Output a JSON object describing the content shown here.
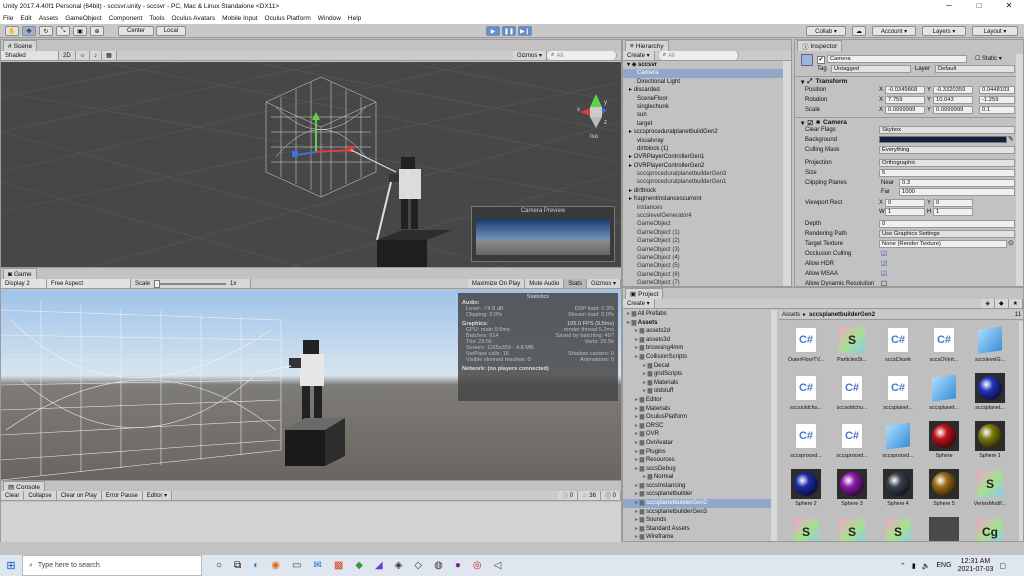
{
  "window": {
    "title": "Unity 2017.4.40f1 Personal (64bit) - sccsvr.unity - sccsvr - PC, Mac & Linux Standalone <DX11>",
    "min": "─",
    "max": "□",
    "close": "✕"
  },
  "menu": [
    "File",
    "Edit",
    "Assets",
    "GameObject",
    "Component",
    "Tools",
    "Oculus Avatars",
    "Mobile Input",
    "Oculus Platform",
    "Window",
    "Help"
  ],
  "toolbar": {
    "center": "Center",
    "local": "Local",
    "collab": "Collab ▾",
    "account": "Account ▾",
    "layers": "Layers ▾",
    "layout": "Layout ▾"
  },
  "scene": {
    "tab": "Scene",
    "shaded": "Shaded",
    "twod": "2D",
    "gizmos": "Gizmos ▾",
    "search": "All",
    "iso": "Iso",
    "axes": {
      "x": "x",
      "y": "y",
      "z": "z"
    }
  },
  "preview": {
    "title": "Camera Preview"
  },
  "game": {
    "tab": "Game",
    "display": "Display 2",
    "aspect": "Free Aspect",
    "scale_label": "Scale",
    "scale_value": "1x",
    "maximize": "Maximize On Play",
    "mute": "Mute Audio",
    "stats": "Stats",
    "gizmos": "Gizmos ▾"
  },
  "stats": {
    "title": "Statistics",
    "audio_h": "Audio:",
    "audio": [
      [
        "Level: -74.8 dB",
        "DSP load: 0.3%"
      ],
      [
        "Clipping: 0.0%",
        "Stream load: 0.0%"
      ]
    ],
    "graphics_h": "Graphics:",
    "fps": "105.0 FPS (9.5ms)",
    "graphics": [
      [
        "CPU: main 9.5ms",
        "render thread 5.2ms"
      ],
      [
        "Batches: 614",
        "Saved by batching: 497"
      ],
      [
        "Tris: 29.5k",
        "Verts: 25.5k"
      ],
      [
        "Screen: 1165x359 - 4.8 MB",
        ""
      ],
      [
        "SetPass calls: 16",
        "Shadow casters: 0"
      ],
      [
        "Visible skinned meshes: 0",
        "Animations: 0"
      ]
    ],
    "network": "Network: (no players connected)"
  },
  "console": {
    "tab": "Console",
    "clear": "Clear",
    "collapse": "Collapse",
    "clear_on_play": "Clear on Play",
    "error_pause": "Error Pause",
    "editor": "Editor ▾",
    "errors": "0",
    "warnings": "36",
    "logs": "0"
  },
  "hierarchy": {
    "tab": "Hierarchy",
    "create": "Create ▾",
    "search": "All",
    "scene": "sccsvr",
    "items": [
      {
        "t": "Camera",
        "sel": true
      },
      {
        "t": "Directional Light"
      },
      {
        "t": "discarded",
        "arrow": true
      },
      {
        "t": "SceneFloor"
      },
      {
        "t": "singlechunk"
      },
      {
        "t": "sun"
      },
      {
        "t": "target"
      },
      {
        "t": "sccsproceduralplanetbuildGen2",
        "arrow": true
      },
      {
        "t": "visualvray"
      },
      {
        "t": "dirtblock (1)"
      },
      {
        "t": "OVRPlayerControllerGen1",
        "arrow": true
      },
      {
        "t": "OVRPlayerControllerGen2",
        "arrow": true
      },
      {
        "t": "sccsproceduralplanetbuilderGen3",
        "g": true
      },
      {
        "t": "sccsproceduralplanetbuilderGen1",
        "g": true
      },
      {
        "t": "dirtblock",
        "arrow": true
      },
      {
        "t": "fragmentinstancescurrent",
        "arrow": true
      },
      {
        "t": "instances",
        "g": true
      },
      {
        "t": "sccslevelGenerator4",
        "g": true
      },
      {
        "t": "GameObject",
        "g": true
      },
      {
        "t": "GameObject (1)",
        "g": true
      },
      {
        "t": "GameObject (2)",
        "g": true
      },
      {
        "t": "GameObject (3)",
        "g": true
      },
      {
        "t": "GameObject (4)",
        "g": true
      },
      {
        "t": "GameObject (5)",
        "g": true
      },
      {
        "t": "GameObject (6)",
        "g": true
      },
      {
        "t": "GameObject (7)",
        "g": true
      }
    ]
  },
  "inspector": {
    "tab": "Inspector",
    "name": "Camera",
    "static": "Static ▾",
    "tag_label": "Tag",
    "tag": "Untagged",
    "layer_label": "Layer",
    "layer": "Default",
    "transform": "Transform",
    "position": "Position",
    "rotation": "Rotation",
    "scale": "Scale",
    "pos": [
      "-0.0349868",
      "-0.3320359",
      "0.0448103"
    ],
    "rot": [
      "7.759",
      "10.043",
      "-1.259"
    ],
    "scl": [
      "0.0999999",
      "0.0999999",
      "0.1"
    ],
    "camera": "Camera",
    "clear_flags": "Clear Flags",
    "clear_flags_v": "Skybox",
    "background": "Background",
    "culling": "Culling Mask",
    "culling_v": "Everything",
    "projection": "Projection",
    "projection_v": "Orthographic",
    "size": "Size",
    "size_v": "5",
    "clipping": "Clipping Planes",
    "near": "Near",
    "near_v": "0.3",
    "far": "Far",
    "far_v": "1000",
    "viewport": "Viewport Rect",
    "vx": "0",
    "vy": "0",
    "vw": "1",
    "vh": "1",
    "depth": "Depth",
    "depth_v": "0",
    "rendering_path": "Rendering Path",
    "rendering_path_v": "Use Graphics Settings",
    "target_texture": "Target Texture",
    "target_texture_v": "None (Render Texture)",
    "occlusion": "Occlusion Culling",
    "hdr": "Allow HDR",
    "msaa": "Allow MSAA",
    "dynres": "Allow Dynamic Resolution",
    "X": "X",
    "Y": "Y",
    "W": "W",
    "H": "H"
  },
  "project": {
    "tab": "Project",
    "create": "Create ▾",
    "breadcrumb_root": "Assets",
    "breadcrumb_sep": "▸",
    "breadcrumb_leaf": "sccsplanetbuilderGen2",
    "count": "11",
    "tree": [
      {
        "t": "All Prefabs",
        "d": 0
      },
      {
        "t": "Assets",
        "d": 0,
        "b": true
      },
      {
        "t": "assets2d",
        "d": 1
      },
      {
        "t": "assets3d",
        "d": 1
      },
      {
        "t": "browsing4mm",
        "d": 1
      },
      {
        "t": "CollisionScripts",
        "d": 1
      },
      {
        "t": "Decal",
        "d": 2
      },
      {
        "t": "gridScripts",
        "d": 2
      },
      {
        "t": "Materials",
        "d": 2
      },
      {
        "t": "oldstuff",
        "d": 2
      },
      {
        "t": "Editor",
        "d": 1
      },
      {
        "t": "Materials",
        "d": 1
      },
      {
        "t": "OculusPlatform",
        "d": 1
      },
      {
        "t": "ORSC",
        "d": 1
      },
      {
        "t": "OVR",
        "d": 1
      },
      {
        "t": "OvrAvatar",
        "d": 1
      },
      {
        "t": "Plugins",
        "d": 1
      },
      {
        "t": "Resources",
        "d": 1
      },
      {
        "t": "sccsDebug",
        "d": 1
      },
      {
        "t": "Normal",
        "d": 2
      },
      {
        "t": "sccsInstancing",
        "d": 1
      },
      {
        "t": "sccsplanetbuilder",
        "d": 1
      },
      {
        "t": "sccsplanetbuilderGen2",
        "d": 1,
        "sel": true
      },
      {
        "t": "sccsplanetbuilderGen3",
        "d": 1
      },
      {
        "t": "Sounds",
        "d": 1
      },
      {
        "t": "Standard Assets",
        "d": 1
      },
      {
        "t": "Wireframe",
        "d": 1
      }
    ],
    "assets": [
      {
        "n": "OuterFloorTV...",
        "k": "script"
      },
      {
        "n": "ParticlesSt...",
        "k": "shader"
      },
      {
        "n": "sccsChunk",
        "k": "script"
      },
      {
        "n": "sccsOVert...",
        "k": "script"
      },
      {
        "n": "sccslevelG...",
        "k": "cube"
      },
      {
        "n": "sccsiuldchu...",
        "k": "script"
      },
      {
        "n": "sccsoldchu...",
        "k": "script"
      },
      {
        "n": "sccsplanet...",
        "k": "script"
      },
      {
        "n": "sccsplanet...",
        "k": "cube"
      },
      {
        "n": "sccsplanet...",
        "k": "sphere",
        "c": "#2332b8"
      },
      {
        "n": "sccsproced...",
        "k": "script"
      },
      {
        "n": "sccsproced...",
        "k": "script"
      },
      {
        "n": "sccsproced...",
        "k": "cube"
      },
      {
        "n": "Sphere",
        "k": "sphere",
        "c": "#c0121c"
      },
      {
        "n": "Sphere 1",
        "k": "sphere",
        "c": "#7a7a10"
      },
      {
        "n": "Sphere 2",
        "k": "sphere",
        "c": "#1b2aa8"
      },
      {
        "n": "Sphere 3",
        "k": "sphere",
        "c": "#8a1aa8"
      },
      {
        "n": "Sphere 4",
        "k": "sphere",
        "c": "#3a4250"
      },
      {
        "n": "Sphere 5",
        "k": "sphere",
        "c": "#9a6a1a"
      },
      {
        "n": "VertexModif...",
        "k": "shader"
      },
      {
        "n": "",
        "k": "shader"
      },
      {
        "n": "",
        "k": "shader"
      },
      {
        "n": "",
        "k": "shader"
      },
      {
        "n": "",
        "k": "mat"
      },
      {
        "n": "",
        "k": "cg"
      }
    ]
  },
  "taskbar": {
    "search": "Type here to search",
    "time": "12:31 AM",
    "date": "2021-07-03",
    "lang": "ENG"
  },
  "colors": {
    "accent": "#5d8fdb",
    "selection": "#8fa7c9",
    "camera_bg": "#15203a"
  }
}
